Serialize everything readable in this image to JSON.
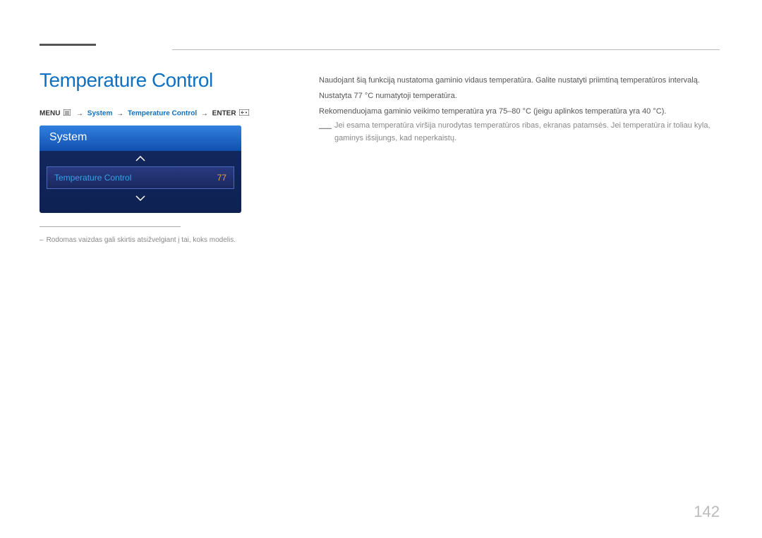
{
  "page": {
    "title": "Temperature Control",
    "number": "142"
  },
  "breadcrumb": {
    "menu_label": "MENU",
    "seg_system": "System",
    "seg_temp": "Temperature Control",
    "enter_label": "ENTER",
    "arrow": "→"
  },
  "osd": {
    "header": "System",
    "item_label": "Temperature Control",
    "item_value": "77"
  },
  "footnote": {
    "text": "Rodomas vaizdas gali skirtis atsižvelgiant į tai, koks modelis."
  },
  "body": {
    "p1": "Naudojant šią funkciją nustatoma gaminio vidaus temperatūra. Galite nustatyti priimtiną temperatūros intervalą.",
    "p2": "Nustatyta 77 °C numatytoji temperatūra.",
    "p3": "Rekomenduojama gaminio veikimo temperatūra yra 75–80 °C (jeigu aplinkos temperatūra yra 40 °C).",
    "note": "Jei esama temperatūra viršija nurodytas temperatūros ribas, ekranas patamsės. Jei temperatūra ir toliau kyla, gaminys išsijungs, kad neperkaistų."
  }
}
